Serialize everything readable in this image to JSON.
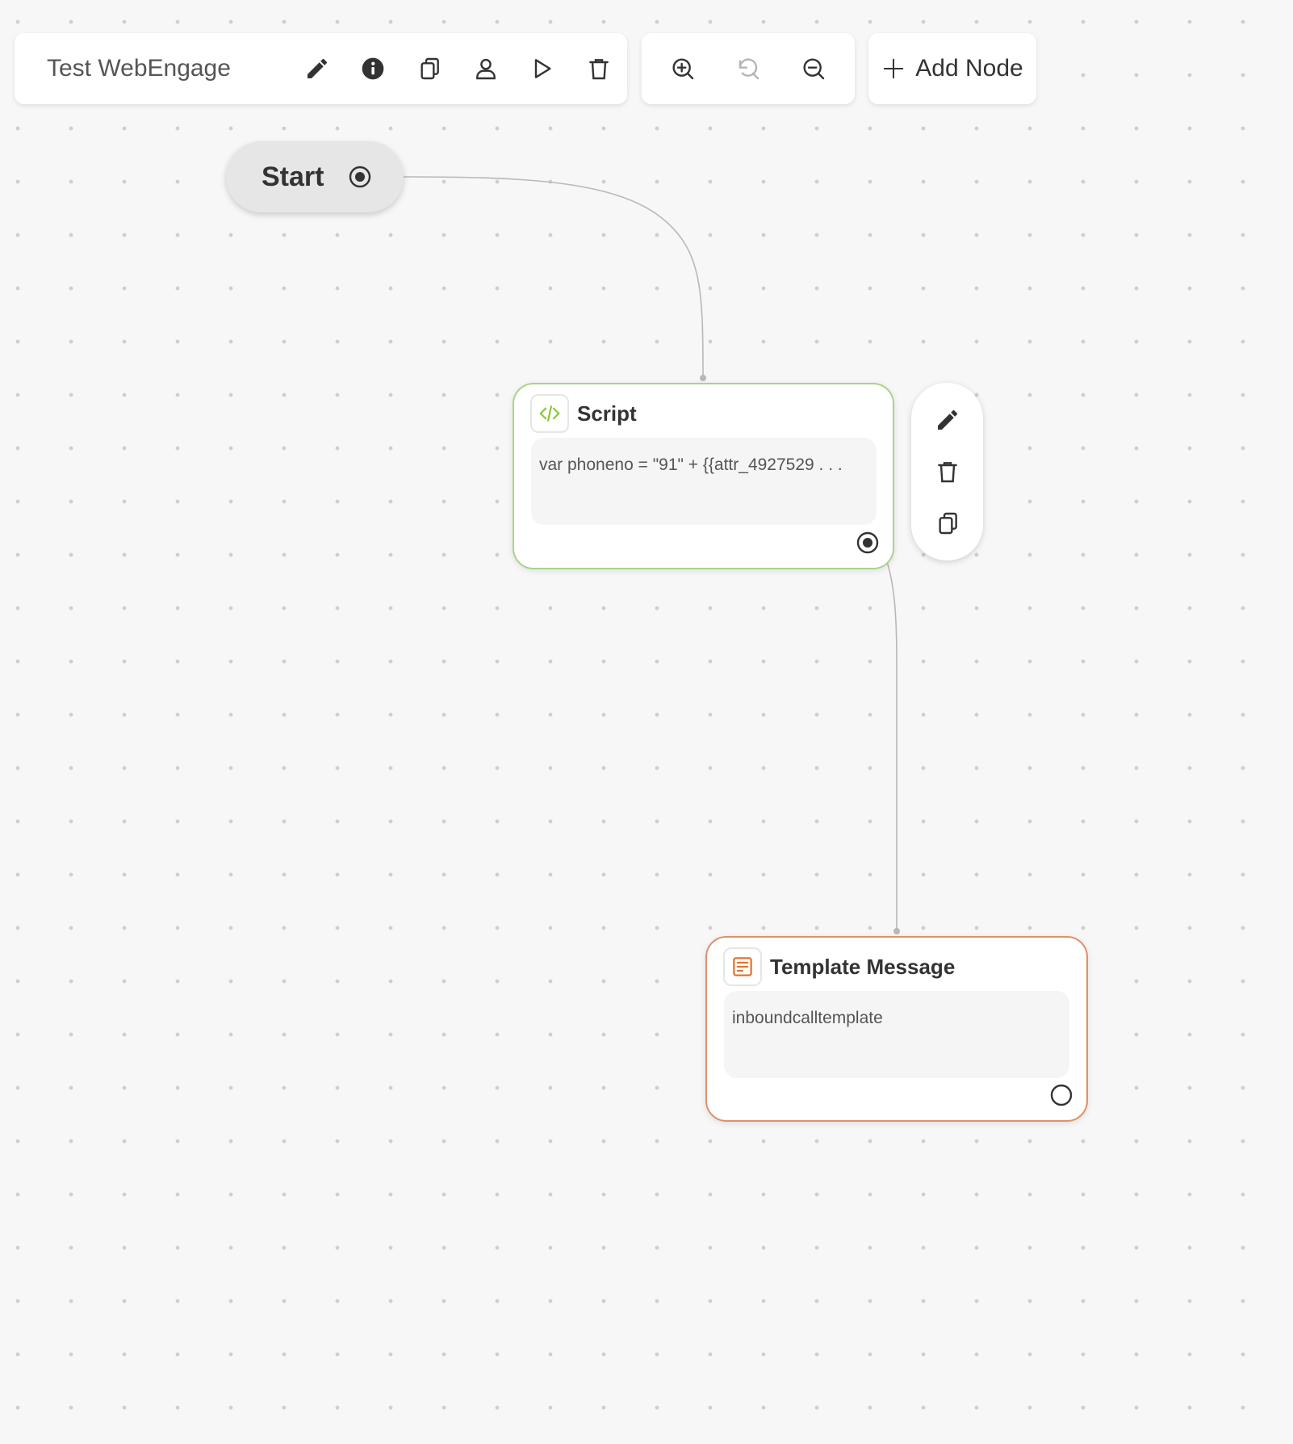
{
  "toolbar": {
    "flow_name": "Test WebEngage",
    "actions": [
      "edit-icon",
      "info-icon",
      "copy-icon",
      "user-icon",
      "play-icon",
      "trash-icon"
    ]
  },
  "zoom": {
    "actions": [
      "zoom-in-icon",
      "reset-zoom-icon",
      "zoom-out-icon"
    ]
  },
  "add_node": {
    "label": "Add Node",
    "icon": "plus-icon"
  },
  "canvas": {
    "start": {
      "label": "Start"
    },
    "nodes": [
      {
        "type": "Script",
        "title": "Script",
        "preview": "var phoneno = \"91\" + {{attr_4927529 . . .",
        "accent": "#a8d48a",
        "icon": "code-icon"
      },
      {
        "type": "Template Message",
        "title": "Template Message",
        "preview": "inboundcalltemplate",
        "accent": "#e0916a",
        "icon": "template-icon"
      }
    ],
    "node_actions": [
      "edit-icon",
      "trash-icon",
      "copy-icon"
    ]
  },
  "colors": {
    "background": "#f7f7f7",
    "script_accent": "#a8d48a",
    "template_accent": "#e0916a",
    "icon": "#333333"
  }
}
